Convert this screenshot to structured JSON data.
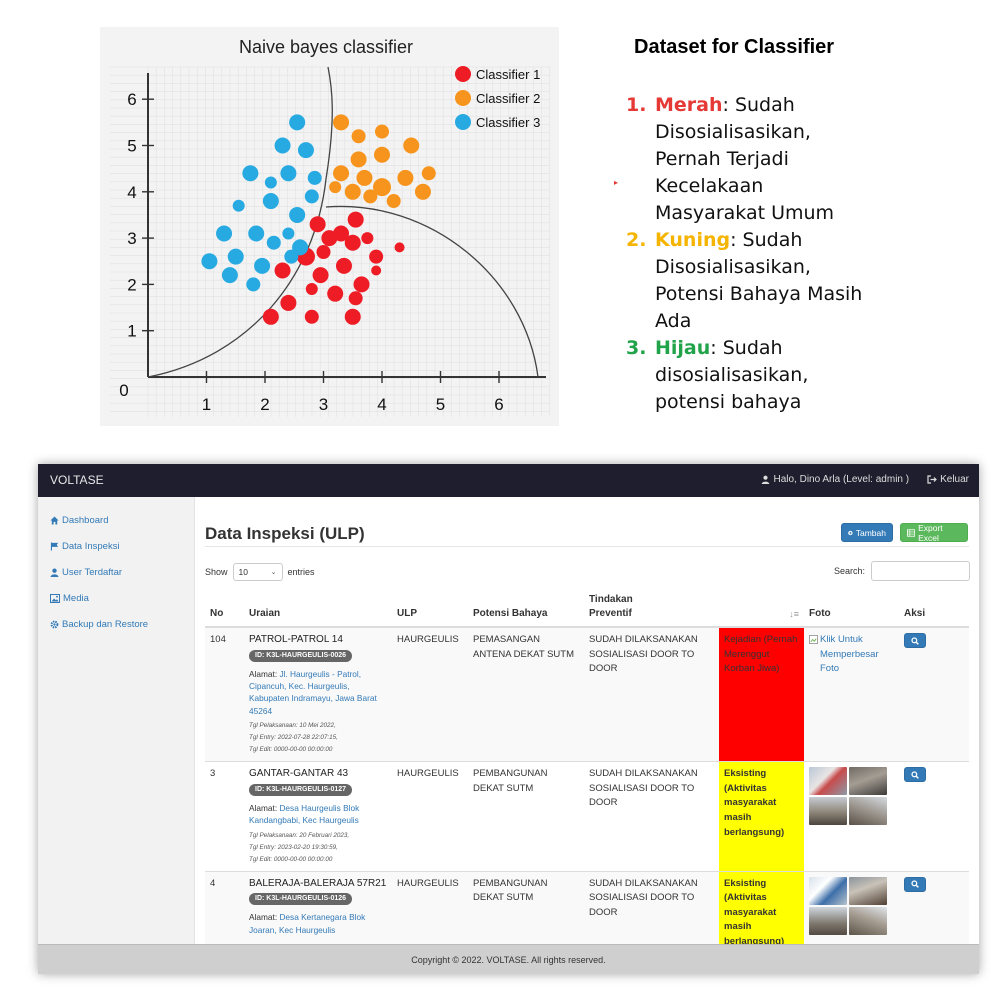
{
  "chart_data": {
    "type": "scatter",
    "title": "Naive bayes classifier",
    "xlim": [
      0,
      6.6
    ],
    "ylim": [
      0,
      6.6
    ],
    "x_ticks": [
      "1",
      "2",
      "3",
      "4",
      "5",
      "6"
    ],
    "y_ticks": [
      "1",
      "2",
      "3",
      "4",
      "5",
      "6"
    ],
    "origin_label": "0",
    "legend_position": "top-right",
    "grid": true,
    "series": [
      {
        "name": "Classifier 1",
        "color": "#ee1c25",
        "points": [
          [
            2.1,
            1.3,
            8
          ],
          [
            2.4,
            1.6,
            8
          ],
          [
            2.8,
            1.3,
            7
          ],
          [
            3.5,
            1.3,
            8
          ],
          [
            2.3,
            2.3,
            8
          ],
          [
            2.7,
            2.6,
            9
          ],
          [
            2.95,
            2.2,
            8
          ],
          [
            2.8,
            1.9,
            6
          ],
          [
            3.2,
            1.8,
            8
          ],
          [
            3.35,
            2.4,
            8
          ],
          [
            3.65,
            2.0,
            8
          ],
          [
            3.55,
            1.7,
            7
          ],
          [
            2.9,
            3.3,
            8
          ],
          [
            3.1,
            3.0,
            8
          ],
          [
            3.3,
            3.1,
            8
          ],
          [
            3.55,
            3.4,
            8
          ],
          [
            3.5,
            2.9,
            8
          ],
          [
            3.9,
            2.6,
            7
          ],
          [
            3.75,
            3.0,
            6
          ],
          [
            3.0,
            2.7,
            7
          ],
          [
            4.3,
            2.8,
            5
          ],
          [
            3.9,
            2.3,
            5
          ]
        ]
      },
      {
        "name": "Classifier 2",
        "color": "#f7941d",
        "points": [
          [
            3.3,
            5.5,
            8
          ],
          [
            3.6,
            5.2,
            7
          ],
          [
            4.0,
            5.3,
            7
          ],
          [
            4.5,
            5.0,
            8
          ],
          [
            4.0,
            4.8,
            8
          ],
          [
            3.6,
            4.7,
            8
          ],
          [
            3.3,
            4.4,
            8
          ],
          [
            3.7,
            4.3,
            8
          ],
          [
            4.0,
            4.1,
            9
          ],
          [
            4.4,
            4.3,
            8
          ],
          [
            4.8,
            4.4,
            7
          ],
          [
            3.5,
            4.0,
            8
          ],
          [
            3.8,
            3.9,
            7
          ],
          [
            4.2,
            3.8,
            7
          ],
          [
            4.7,
            4.0,
            8
          ],
          [
            3.2,
            4.1,
            6
          ]
        ]
      },
      {
        "name": "Classifier 3",
        "color": "#27a9e1",
        "points": [
          [
            2.55,
            5.5,
            8
          ],
          [
            2.3,
            5.0,
            8
          ],
          [
            2.7,
            4.9,
            8
          ],
          [
            1.75,
            4.4,
            8
          ],
          [
            2.1,
            4.2,
            6
          ],
          [
            2.4,
            4.4,
            8
          ],
          [
            2.85,
            4.3,
            7
          ],
          [
            1.55,
            3.7,
            6
          ],
          [
            2.1,
            3.8,
            8
          ],
          [
            2.55,
            3.5,
            8
          ],
          [
            2.8,
            3.9,
            7
          ],
          [
            1.3,
            3.1,
            8
          ],
          [
            1.85,
            3.1,
            8
          ],
          [
            2.15,
            2.9,
            7
          ],
          [
            2.4,
            3.1,
            6
          ],
          [
            2.6,
            2.8,
            8
          ],
          [
            1.05,
            2.5,
            8
          ],
          [
            1.5,
            2.6,
            8
          ],
          [
            1.95,
            2.4,
            8
          ],
          [
            2.45,
            2.6,
            7
          ],
          [
            1.4,
            2.2,
            8
          ],
          [
            1.8,
            2.0,
            7
          ]
        ]
      }
    ]
  },
  "dataset": {
    "title": "Dataset for Classifier",
    "items": [
      {
        "num": "1.",
        "key": "Merah",
        "color": "#e53935",
        "rest_first": ": Sudah",
        "lines": [
          "Disosialisasikan,",
          "Pernah Terjadi",
          "Kecelakaan",
          "Masyarakat Umum"
        ]
      },
      {
        "num": "2.",
        "key": "Kuning",
        "color": "#f5b400",
        "rest_first": ": Sudah",
        "lines": [
          "Disosialisasikan,",
          "Potensi Bahaya Masih",
          "Ada"
        ]
      },
      {
        "num": "3.",
        "key": "Hijau",
        "color": "#21a34a",
        "rest_first": ": Sudah",
        "lines": [
          "disosialisasikan,",
          "potensi bahaya"
        ]
      }
    ]
  },
  "app": {
    "brand": "VOLTASE",
    "user_label": "Halo, Dino Arla (Level: admin )",
    "logout_label": "Keluar",
    "sidebar": [
      {
        "label": "Dashboard",
        "icon": "home-icon"
      },
      {
        "label": "Data Inspeksi",
        "icon": "flag-icon"
      },
      {
        "label": "User Terdaftar",
        "icon": "user-icon"
      },
      {
        "label": "Media",
        "icon": "image-icon"
      },
      {
        "label": "Backup dan Restore",
        "icon": "gear-icon"
      }
    ],
    "page_title": "Data Inspeksi (ULP)",
    "btn_tambah": "Tambah",
    "btn_export": "Export Excel",
    "show_label": "Show",
    "show_value": "10",
    "entries_label": "entries",
    "search_label": "Search:",
    "columns": {
      "no": "No",
      "uraian": "Uraian",
      "ulp": "ULP",
      "potensi": "Potensi Bahaya",
      "tindakan_1": "Tindakan",
      "tindakan_2": "Preventif",
      "foto": "Foto",
      "aksi": "Aksi"
    },
    "rows": [
      {
        "no": "104",
        "title": "PATROL-PATROL 14",
        "id": "ID: K3L-HAURGEULIS-0026",
        "alamat_label": "Alamat: ",
        "alamat": "Jl. Haurgeulis - Patrol, Cipancuh, Kec. Haurgeulis, Kabupaten Indramayu, Jawa Barat 45264",
        "tgl_pelaksanaan": "Tgl Pelaksanaan: 10 Mei 2022,",
        "tgl_entry": "Tgl Entry: 2022-07-28 22:07:15,",
        "tgl_edit": "Tgl Edit: 0000-00-00 00:00:00",
        "ulp": "HAURGEULIS",
        "potensi": "PEMASANGAN ANTENA DEKAT SUTM",
        "tindakan": "SUDAH DILAKSANAKAN SOSIALISASI DOOR TO DOOR",
        "status": "Kejadian (Pernah Merenggut Korban Jiwa)",
        "status_color": "red",
        "foto_text": "Klik Untuk Memperbesar Foto"
      },
      {
        "no": "3",
        "title": "GANTAR-GANTAR 43",
        "id": "ID: K3L-HAURGEULIS-0127",
        "alamat_label": "Alamat: ",
        "alamat": "Desa Haurgeulis Blok Kandangbabi, Kec Haurgeulis",
        "tgl_pelaksanaan": "Tgl Pelaksanaan: 20 Februari 2023,",
        "tgl_entry": "Tgl Entry: 2023-02-20 19:30:59,",
        "tgl_edit": "Tgl Edit: 0000-00-00 00:00:00",
        "ulp": "HAURGEULIS",
        "potensi": "PEMBANGUNAN DEKAT SUTM",
        "tindakan": "SUDAH DILAKSANAKAN SOSIALISASI DOOR TO DOOR",
        "status": "Eksisting (Aktivitas masyarakat masih berlangsung)",
        "status_color": "yellow"
      },
      {
        "no": "4",
        "title": "BALERAJA-BALERAJA 57R21",
        "id": "ID: K3L-HAURGEULIS-0126",
        "alamat_label": "Alamat: ",
        "alamat": "Desa Kertanegara Blok Joaran, Kec Haurgeulis",
        "ulp": "HAURGEULIS",
        "potensi": "PEMBANGUNAN DEKAT SUTM",
        "tindakan": "SUDAH DILAKSANAKAN SOSIALISASI DOOR TO DOOR",
        "status": "Eksisting (Aktivitas masyarakat masih berlangsung)",
        "status_color": "yellow"
      }
    ],
    "footer": "Copyright © 2022. VOLTASE. All rights reserved."
  }
}
